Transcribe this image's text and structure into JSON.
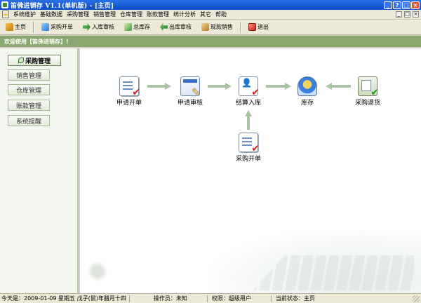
{
  "window": {
    "title": "笛佛进销存 V1.1(单机版) - [主页]",
    "controls": [
      "_",
      "?",
      "□",
      "×"
    ]
  },
  "menu": {
    "items": [
      "系统维护",
      "基础数据",
      "采购管理",
      "销售管理",
      "仓库管理",
      "账款管理",
      "统计分析",
      "其它",
      "帮助"
    ],
    "mdi_controls": [
      "_",
      "□",
      "×"
    ]
  },
  "toolbar": {
    "buttons": [
      {
        "label": "主页",
        "icon": "home-icon"
      },
      {
        "label": "采购开单",
        "icon": "purchase-order-icon"
      },
      {
        "label": "入库审核",
        "icon": "inbound-arrow-icon"
      },
      {
        "label": "总库存",
        "icon": "inventory-icon"
      },
      {
        "label": "出库审核",
        "icon": "outbound-arrow-icon"
      },
      {
        "label": "现款销售",
        "icon": "cash-sale-icon"
      },
      {
        "label": "退出",
        "icon": "exit-icon"
      }
    ]
  },
  "welcome": {
    "text": "欢迎使用【笛佛进销存】!"
  },
  "nav": {
    "items": [
      {
        "label": "采购管理",
        "active": true
      },
      {
        "label": "销售管理",
        "active": false
      },
      {
        "label": "仓库管理",
        "active": false
      },
      {
        "label": "账款管理",
        "active": false
      },
      {
        "label": "系统提醒",
        "active": false
      }
    ]
  },
  "flow": {
    "nodes": [
      {
        "label": "申请开单",
        "icon": "request-order-icon"
      },
      {
        "label": "申请审核",
        "icon": "review-icon"
      },
      {
        "label": "结算入库",
        "icon": "settle-inbound-icon"
      },
      {
        "label": "库存",
        "icon": "stock-icon"
      },
      {
        "label": "采购退货",
        "icon": "purchase-return-icon"
      },
      {
        "label": "采购开单",
        "icon": "purchase-order-icon"
      }
    ]
  },
  "status": {
    "date": "今天是：2009-01-09 星期五 戊子(鼠)年腊月十四",
    "operator": "操作员：未知",
    "permission": "权限：超级用户",
    "state": "当前状态：主页"
  },
  "colors": {
    "titlebar": "#0a4ec8",
    "welcome_bar": "#8aa86f",
    "arrow": "#a9c4a2",
    "check_red": "#d02020"
  }
}
